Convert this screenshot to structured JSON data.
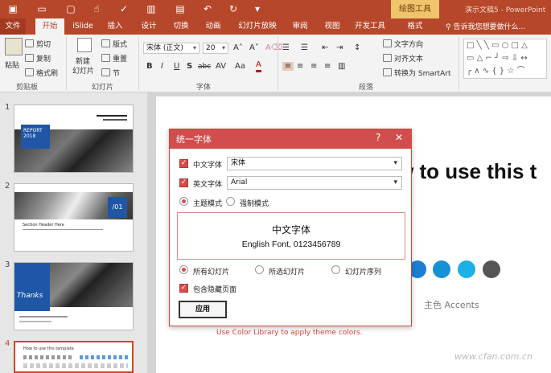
{
  "titlebar": {
    "context_tab": "绘图工具",
    "doc_title": "演示文稿5 - PowerPoint"
  },
  "tabs": [
    "文件",
    "开始",
    "iSlide",
    "插入",
    "设计",
    "切换",
    "动画",
    "幻灯片放映",
    "审阅",
    "视图",
    "开发工具",
    "格式"
  ],
  "tell_me": "告诉我您想要做什么...",
  "ribbon": {
    "clipboard": {
      "paste": "粘贴",
      "cut": "剪切",
      "copy": "复制",
      "format_painter": "格式刷",
      "group": "剪贴板"
    },
    "slides": {
      "new_slide_1": "新建",
      "new_slide_2": "幻灯片",
      "layout": "版式",
      "reset": "重置",
      "section": "节",
      "group": "幻灯片"
    },
    "font": {
      "font_name": "宋体 (正文)",
      "font_size": "20",
      "group": "字体"
    },
    "paragraph": {
      "text_direction": "文字方向",
      "align_text": "对齐文本",
      "smartart": "转换为 SmartArt",
      "group": "段落"
    }
  },
  "thumbs": [
    {
      "num": "1",
      "line1": "REPORT",
      "line2": "2018"
    },
    {
      "num": "2",
      "label": "/01",
      "text": "Section Header Here"
    },
    {
      "num": "3",
      "label": "Thanks"
    },
    {
      "num": "4",
      "text": "How to use this template"
    }
  ],
  "slide": {
    "title": "w to use this t",
    "accents": "主色 Accents",
    "colorlib": "Use Color Library to apply theme colors.",
    "dot_colors": [
      "#1a7fd4",
      "#1591d6",
      "#1bb0e8",
      "#555555"
    ]
  },
  "dialog": {
    "title": "统一字体",
    "help": "?",
    "close": "✕",
    "cn_font_label": "中文字体",
    "cn_font_value": "宋体",
    "en_font_label": "英文字体",
    "en_font_value": "Arial",
    "mode_theme": "主题模式",
    "mode_force": "强制模式",
    "preview_cn": "中文字体",
    "preview_en": "English Font, 0123456789",
    "scope_all": "所有幻灯片",
    "scope_selected": "所选幻灯片",
    "scope_sequence": "幻灯片序列",
    "include_hidden": "包含隐藏页面",
    "apply": "应用"
  },
  "watermark": "www.cfan.com.cn",
  "colors": {
    "brand": "#b7472a",
    "dialog_accent": "#d24e4e"
  }
}
